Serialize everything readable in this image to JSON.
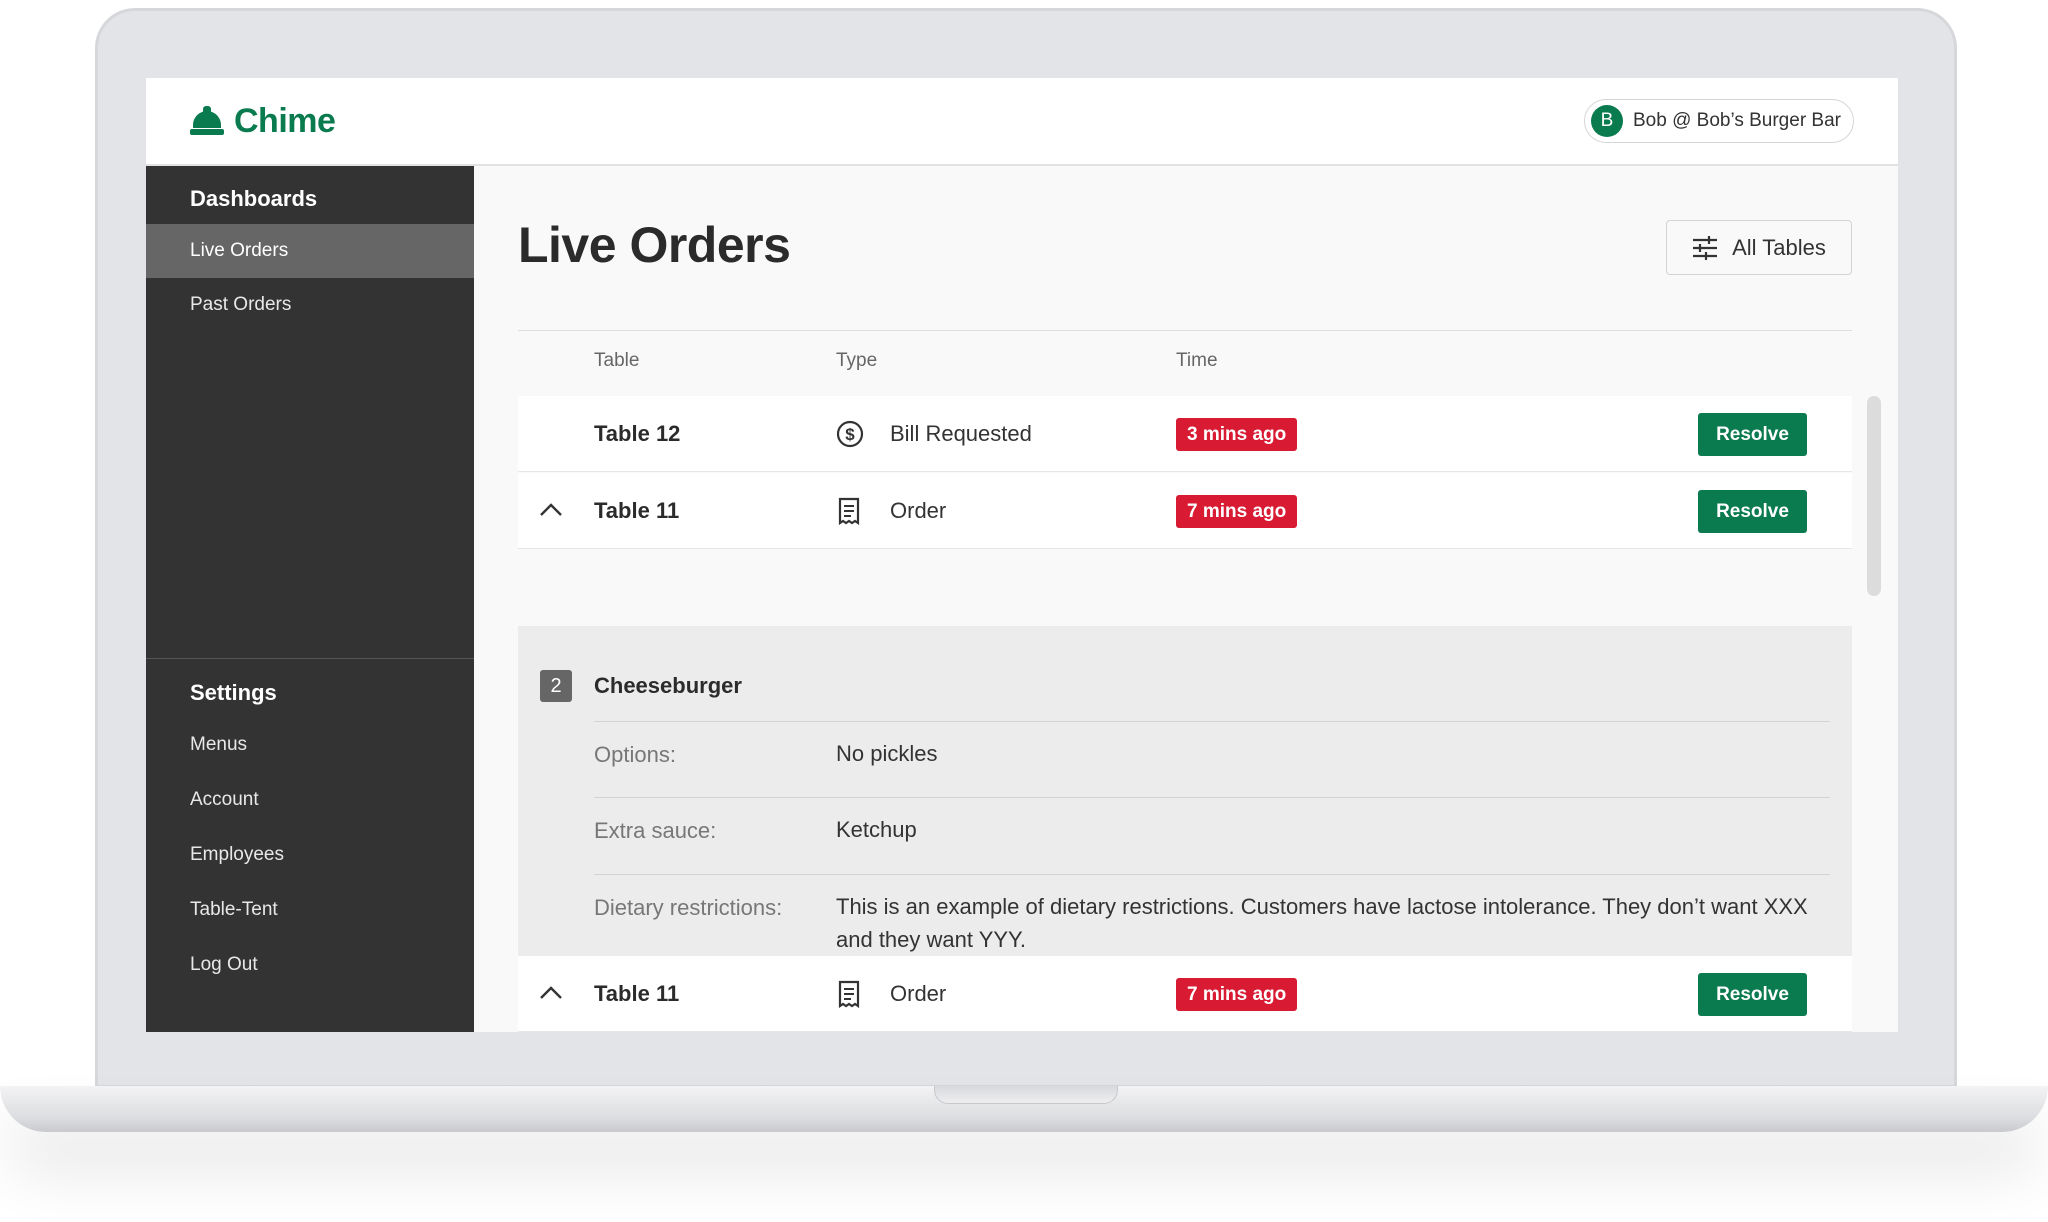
{
  "app": {
    "brand": "Chime",
    "user": {
      "initial": "B",
      "label": "Bob @ Bob’s Burger Bar"
    }
  },
  "sidebar": {
    "dashboards_heading": "Dashboards",
    "dashboards": [
      {
        "label": "Live Orders",
        "active": true
      },
      {
        "label": "Past Orders",
        "active": false
      }
    ],
    "settings_heading": "Settings",
    "settings": [
      {
        "label": "Menus"
      },
      {
        "label": "Account"
      },
      {
        "label": "Employees"
      },
      {
        "label": "Table-Tent"
      },
      {
        "label": "Log Out"
      }
    ]
  },
  "main": {
    "title": "Live Orders",
    "filter": {
      "label": "All Tables",
      "icon": "sliders-icon"
    },
    "columns": {
      "table": "Table",
      "type": "Type",
      "time": "Time"
    },
    "rows": [
      {
        "table": "Table 12",
        "type": "Bill Requested",
        "type_icon": "dollar-circle-icon",
        "time": "3 mins ago",
        "action": "Resolve",
        "expanded": false
      },
      {
        "table": "Table 11",
        "type": "Order",
        "type_icon": "receipt-icon",
        "time": "7 mins ago",
        "action": "Resolve",
        "expanded": true
      },
      {
        "table": "Table 11",
        "type": "Order",
        "type_icon": "receipt-icon",
        "time": "7 mins ago",
        "action": "Resolve",
        "expanded": true
      }
    ],
    "order_detail": {
      "quantity": "2",
      "item": "Cheeseburger",
      "fields": [
        {
          "key": "Options:",
          "value": "No pickles"
        },
        {
          "key": "Extra sauce:",
          "value": "Ketchup"
        },
        {
          "key": "Dietary restrictions:",
          "value": "This is an example of dietary restrictions. Customers have lactose intolerance. They don’t want XXX and they want YYY."
        }
      ]
    }
  },
  "colors": {
    "brand_green": "#0a7a4f",
    "alert_red": "#d81b33",
    "sidebar_bg": "#333333",
    "sidebar_active": "#666666"
  }
}
